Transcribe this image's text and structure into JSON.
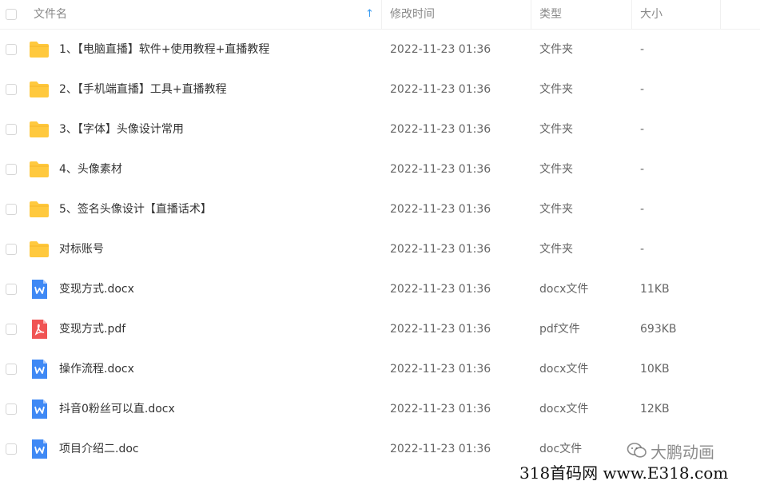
{
  "header": {
    "name": "文件名",
    "sort_icon": "arrow-up-icon",
    "modified": "修改时间",
    "type": "类型",
    "size": "大小"
  },
  "colors": {
    "folder": "#FFC93E",
    "word": "#3F89F5",
    "pdf": "#F05454",
    "sort_arrow": "#3B9CF2"
  },
  "files": [
    {
      "name": "1、【电脑直播】软件+使用教程+直播教程",
      "modified": "2022-11-23 01:36",
      "type": "文件夹",
      "size": "-",
      "icon": "folder-icon"
    },
    {
      "name": "2、【手机端直播】工具+直播教程",
      "modified": "2022-11-23 01:36",
      "type": "文件夹",
      "size": "-",
      "icon": "folder-icon"
    },
    {
      "name": "3、【字体】头像设计常用",
      "modified": "2022-11-23 01:36",
      "type": "文件夹",
      "size": "-",
      "icon": "folder-icon"
    },
    {
      "name": "4、头像素材",
      "modified": "2022-11-23 01:36",
      "type": "文件夹",
      "size": "-",
      "icon": "folder-icon"
    },
    {
      "name": "5、签名头像设计【直播话术】",
      "modified": "2022-11-23 01:36",
      "type": "文件夹",
      "size": "-",
      "icon": "folder-icon"
    },
    {
      "name": "对标账号",
      "modified": "2022-11-23 01:36",
      "type": "文件夹",
      "size": "-",
      "icon": "folder-icon"
    },
    {
      "name": "变现方式.docx",
      "modified": "2022-11-23 01:36",
      "type": "docx文件",
      "size": "11KB",
      "icon": "word-doc-icon"
    },
    {
      "name": "变现方式.pdf",
      "modified": "2022-11-23 01:36",
      "type": "pdf文件",
      "size": "693KB",
      "icon": "pdf-icon"
    },
    {
      "name": "操作流程.docx",
      "modified": "2022-11-23 01:36",
      "type": "docx文件",
      "size": "10KB",
      "icon": "word-doc-icon"
    },
    {
      "name": "抖音0粉丝可以直.docx",
      "modified": "2022-11-23 01:36",
      "type": "docx文件",
      "size": "12KB",
      "icon": "word-doc-icon"
    },
    {
      "name": "项目介绍二.doc",
      "modified": "2022-11-23 01:36",
      "type": "doc文件",
      "size": "",
      "icon": "word-doc-icon"
    }
  ],
  "watermarks": {
    "wechat": "大鹏动画",
    "site": "318首码网 www.E318.com"
  }
}
